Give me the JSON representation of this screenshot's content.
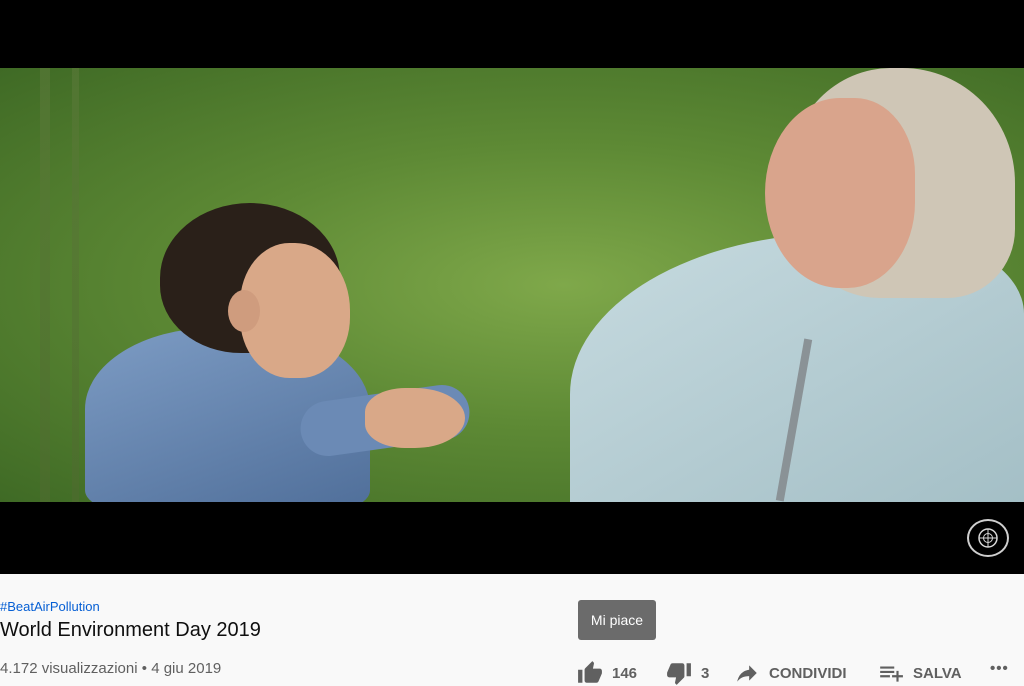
{
  "video": {
    "logo_text": "UN"
  },
  "info": {
    "hashtag": "#BeatAirPollution",
    "title": "World Environment Day 2019",
    "views": "4.172 visualizzazioni",
    "separator": "•",
    "date": "4 giu 2019"
  },
  "tooltip": {
    "like": "Mi piace"
  },
  "actions": {
    "like_count": "146",
    "dislike_count": "3",
    "share_label": "CONDIVIDI",
    "save_label": "SALVA",
    "more_label": "•••"
  }
}
